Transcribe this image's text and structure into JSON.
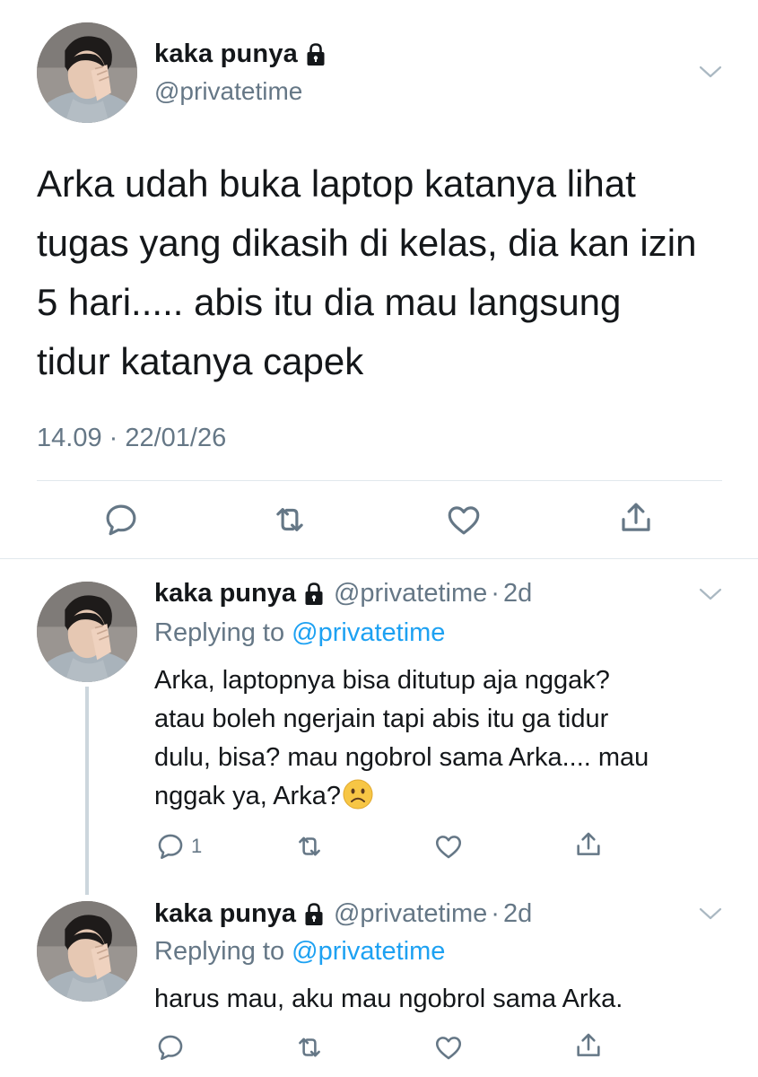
{
  "main_tweet": {
    "name": "kaka punya",
    "handle": "@privatetime",
    "text_lines": [
      "Arka udah buka laptop katanya lihat",
      "tugas yang dikasih di kelas, dia kan izin",
      "5 hari..... abis itu dia mau langsung",
      "tidur katanya capek"
    ],
    "timestamp": "14.09 · 22/01/26",
    "icons": {
      "reply": "reply-icon",
      "retweet": "retweet-icon",
      "like": "heart-icon",
      "share": "share-icon",
      "menu": "chevron-down-icon",
      "protected": "lock-icon"
    }
  },
  "replies": [
    {
      "name": "kaka punya",
      "handle": "@privatetime",
      "separator": "·",
      "time": "2d",
      "replying_prefix": "Replying to",
      "replying_to": "@privatetime",
      "text_lines": [
        "Arka, laptopnya bisa ditutup aja nggak?",
        "atau boleh ngerjain tapi abis itu ga tidur",
        "dulu, bisa? mau ngobrol sama Arka.... mau",
        "nggak ya, Arka?"
      ],
      "trailing_emoji": "frowning-face-emoji",
      "reply_count": "1"
    },
    {
      "name": "kaka punya",
      "handle": "@privatetime",
      "separator": "·",
      "time": "2d",
      "replying_prefix": "Replying to",
      "replying_to": "@privatetime",
      "text_lines": [
        "harus mau, aku mau ngobrol sama Arka."
      ],
      "reply_count": ""
    }
  ],
  "colors": {
    "text": "#14171a",
    "secondary": "#657786",
    "link": "#1da1f2",
    "divider": "#e1e8ed",
    "thread_line": "#ccd6dd"
  }
}
